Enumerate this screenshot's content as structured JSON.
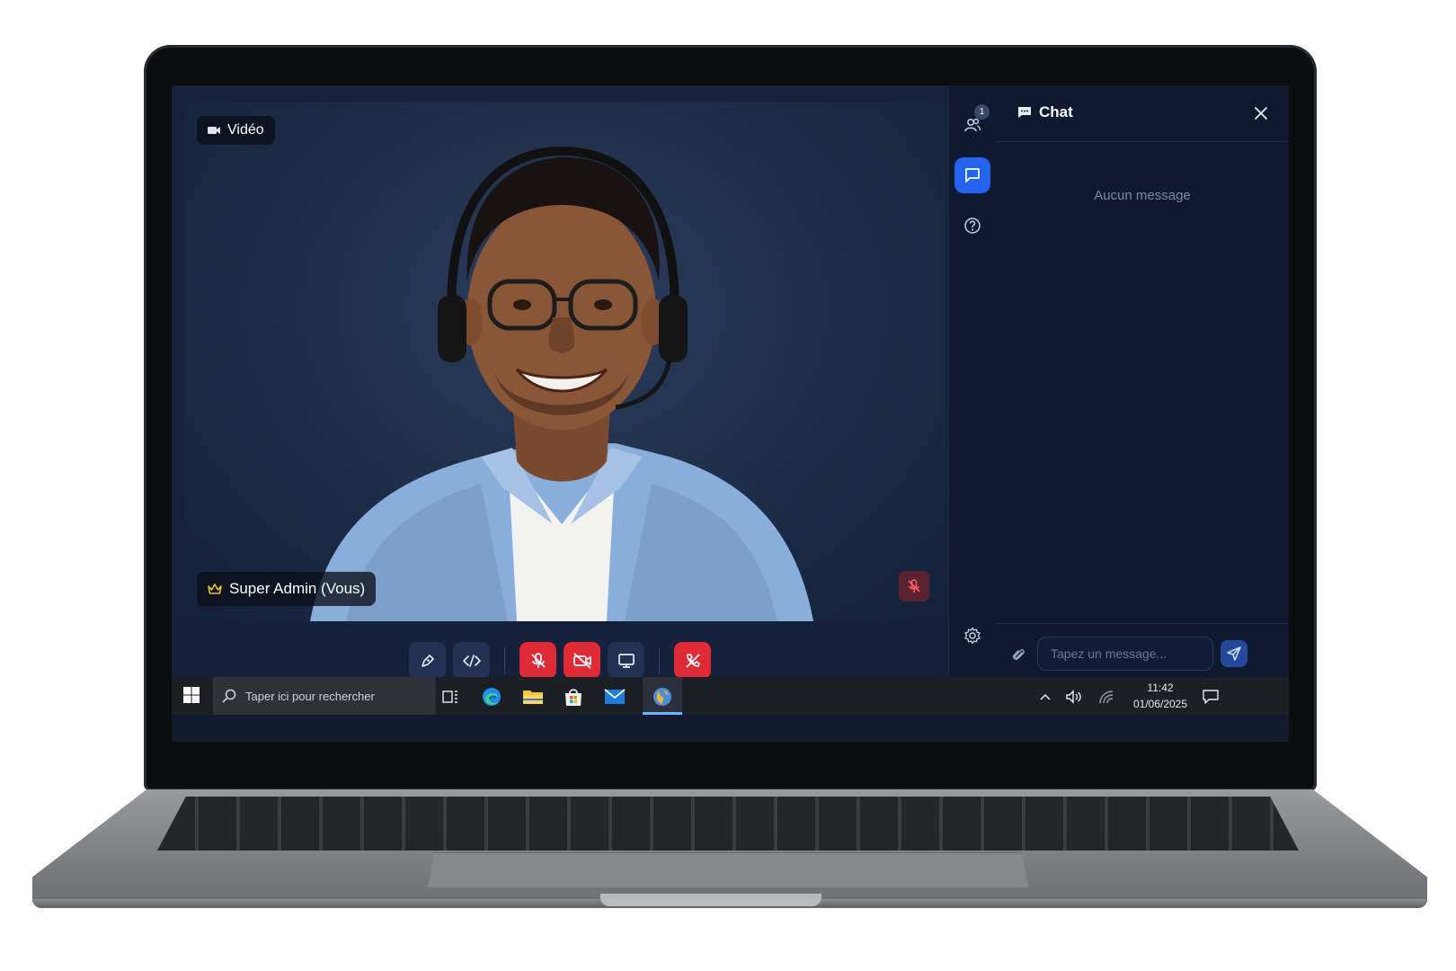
{
  "video": {
    "badge_label": "Vidéo",
    "participant_name": "Super Admin (Vous)"
  },
  "controls": {
    "buttons": [
      "annotate-pen",
      "code",
      "mic-off",
      "camera-off",
      "screen-share",
      "end-call"
    ]
  },
  "rail": {
    "participants_count": "1"
  },
  "chat": {
    "title": "Chat",
    "empty_text": "Aucun message",
    "input_placeholder": "Tapez un message..."
  },
  "taskbar": {
    "search_placeholder": "Taper ici pour rechercher",
    "time": "11:42",
    "date": "01/06/2025"
  },
  "colors": {
    "accent": "#2463eb",
    "danger": "#e02a35",
    "panel": "#0f1a31"
  }
}
